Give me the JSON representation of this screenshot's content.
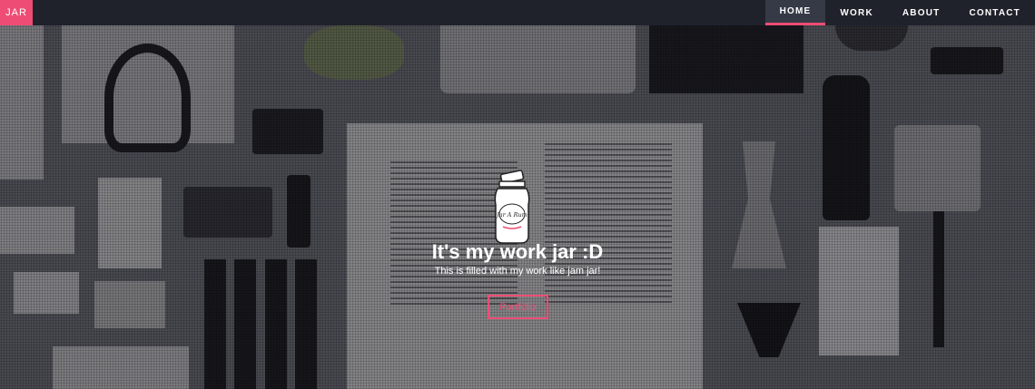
{
  "navbar": {
    "brand": "JAR",
    "items": [
      {
        "label": "HOME",
        "active": true
      },
      {
        "label": "WORK",
        "active": false
      },
      {
        "label": "ABOUT",
        "active": false
      },
      {
        "label": "CONTACT",
        "active": false
      }
    ]
  },
  "hero": {
    "logo_text": "Jar A Rum",
    "headline": "It's my work jar :D",
    "subheadline": "This is filled with my work like jam jar!",
    "cta_label": "Portfolio"
  },
  "colors": {
    "accent": "#ee4c74",
    "navbar_bg": "#1f222b",
    "active_nav_bg": "#353a46"
  }
}
